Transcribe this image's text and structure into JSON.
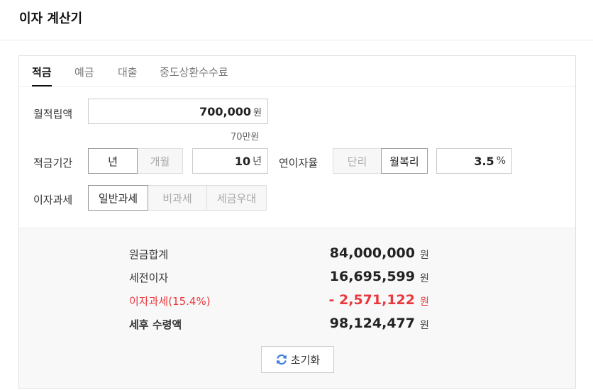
{
  "header": {
    "title": "이자 계산기"
  },
  "tabs": [
    {
      "label": "적금",
      "active": true
    },
    {
      "label": "예금",
      "active": false
    },
    {
      "label": "대출",
      "active": false
    },
    {
      "label": "중도상환수수료",
      "active": false
    }
  ],
  "form": {
    "monthly_label": "월적립액",
    "monthly_value": "700,000",
    "monthly_unit": "원",
    "monthly_hint": "70만원",
    "period_label": "적금기간",
    "period_year": "년",
    "period_month": "개월",
    "period_value": "10",
    "period_unit": "년",
    "rate_label": "연이자율",
    "rate_simple": "단리",
    "rate_compound": "월복리",
    "rate_value": "3.5",
    "rate_unit": "%",
    "tax_label": "이자과세",
    "tax_general": "일반과세",
    "tax_none": "비과세",
    "tax_pref": "세금우대"
  },
  "result": {
    "principal_label": "원금합계",
    "principal_value": "84,000,000",
    "pretax_label": "세전이자",
    "pretax_value": "16,695,599",
    "tax_label": "이자과세(15.4%)",
    "tax_value": "- 2,571,122",
    "net_label": "세후 수령액",
    "net_value": "98,124,477",
    "unit": "원"
  },
  "reset_label": "초기화",
  "colors": {
    "accent_red": "#e8383d",
    "reset_icon": "#3b7ddd"
  }
}
